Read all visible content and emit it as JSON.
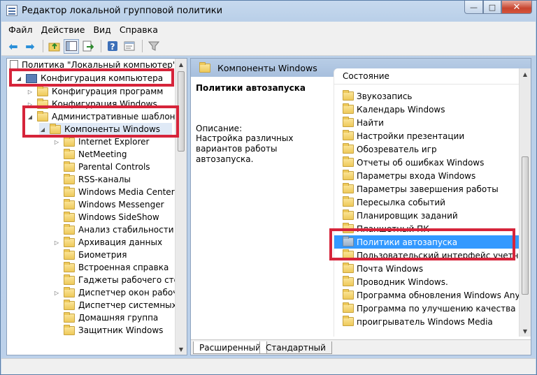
{
  "window": {
    "title": "Редактор локальной групповой политики",
    "minimize": "—",
    "maximize": "□",
    "close": "✕"
  },
  "menu": [
    "Файл",
    "Действие",
    "Вид",
    "Справка"
  ],
  "toolbar": {
    "buttons": [
      "back-icon",
      "forward-icon",
      "up-folder-icon",
      "show-hide-tree-icon",
      "export-icon",
      "help-icon",
      "properties-icon",
      "filter-icon"
    ]
  },
  "tree": {
    "root": "Политика \"Локальный компьютер\"",
    "computer_config": "Конфигурация компьютера",
    "program_config": "Конфигурация программ",
    "windows_config": "Конфигурация Windows",
    "admin_templates": "Административные шаблоны",
    "windows_components": "Компоненты Windows",
    "children": [
      "Internet Explorer",
      "NetMeeting",
      "Parental Controls",
      "RSS-каналы",
      "Windows Media Center",
      "Windows Messenger",
      "Windows SideShow",
      "Анализ стабильности Wir",
      "Архивация данных",
      "Биометрия",
      "Встроенная справка",
      "Гаджеты рабочего стола",
      "Диспетчер окон рабочего",
      "Диспетчер системных ре",
      "Домашняя группа",
      "Защитник Windows"
    ]
  },
  "right": {
    "header": "Компоненты Windows",
    "desc_title": "Политики автозапуска",
    "desc_label": "Описание:",
    "desc_text": "Настройка различных вариантов работы автозапуска.",
    "list_header": "Состояние",
    "items": [
      "Звукозапись",
      "Календарь Windows",
      "Найти",
      "Настройки презентации",
      "Обозреватель игр",
      "Отчеты об ошибках Windows",
      "Параметры входа Windows",
      "Параметры завершения работы",
      "Пересылка событий",
      "Планировщик заданий",
      "Планшетный ПК",
      "Политики автозапуска",
      "Пользовательский интерфейс учетных",
      "Почта Windows",
      "Проводник Windows.",
      "Программа обновления Windows Anytime",
      "Программа по улучшению качества прогр",
      "проигрыватель Windows Media"
    ],
    "selected_index": 11,
    "tabs": [
      "Расширенный",
      "Стандартный"
    ],
    "active_tab": 0
  },
  "colors": {
    "highlight": "#d6243a",
    "selection": "#3399ff"
  }
}
